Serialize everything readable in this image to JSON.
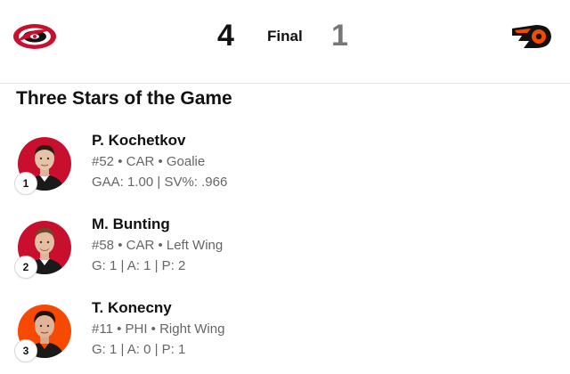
{
  "header": {
    "home_team": "CAR",
    "home_score": "4",
    "status": "Final",
    "away_team": "PHI",
    "away_score": "1",
    "home_logo_icon": "hurricanes-logo-icon",
    "away_logo_icon": "flyers-logo-icon"
  },
  "section": {
    "title": "Three Stars of the Game"
  },
  "stars": [
    {
      "rank": "1",
      "name": "P. Kochetkov",
      "info": "#52 • CAR • Goalie",
      "stats": "GAA: 1.00 | SV%: .966",
      "avatar_bg": "#c8102e"
    },
    {
      "rank": "2",
      "name": "M. Bunting",
      "info": "#58 • CAR • Left Wing",
      "stats": "G: 1 | A: 1 | P: 2",
      "avatar_bg": "#c8102e"
    },
    {
      "rank": "3",
      "name": "T. Konecny",
      "info": "#11 • PHI • Right Wing",
      "stats": "G: 1 | A: 0 | P: 1",
      "avatar_bg": "#f74902"
    }
  ],
  "colors": {
    "hurricanes_red": "#c8102e",
    "flyers_orange": "#f74902",
    "text_primary": "#111111",
    "text_secondary": "#666666"
  }
}
